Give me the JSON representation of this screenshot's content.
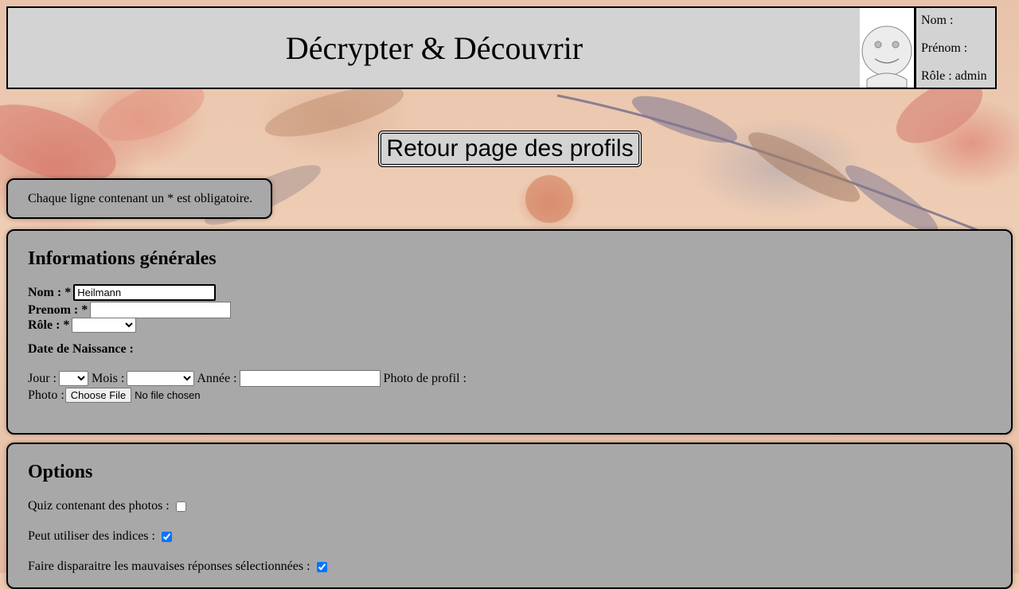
{
  "header": {
    "title": "Décrypter & Découvrir"
  },
  "user": {
    "nom_label": "Nom :",
    "prenom_label": "Prénom :",
    "role_label": "Rôle : admin",
    "avatar_icon": "default-avatar-icon"
  },
  "nav": {
    "back_label": "Retour page des profils"
  },
  "notice": {
    "text": "Chaque ligne contenant un * est obligatoire."
  },
  "general": {
    "title": "Informations générales",
    "nom_label": "Nom : *",
    "nom_value": "Heilmann",
    "prenom_label": "Prenom : *",
    "prenom_value": "",
    "role_label": "Rôle : *",
    "role_value": "",
    "birth_label": "Date de Naissance :",
    "jour_label": "Jour :",
    "mois_label": "Mois :",
    "annee_label": "Année :",
    "annee_value": "",
    "photo_profil_label": "Photo de profil :",
    "photo_label": "Photo :",
    "choose_file_label": "Choose File",
    "no_file_text": "No file chosen"
  },
  "options": {
    "title": "Options",
    "items": [
      {
        "label": "Quiz contenant des photos :",
        "checked": false
      },
      {
        "label": "Peut utiliser des indices :",
        "checked": true
      },
      {
        "label": "Faire disparaitre les mauvaises réponses sélectionnées :",
        "checked": true
      }
    ]
  },
  "colors": {
    "panel": "#a8a8a8",
    "header": "#d3d3d3",
    "border": "#000000"
  }
}
